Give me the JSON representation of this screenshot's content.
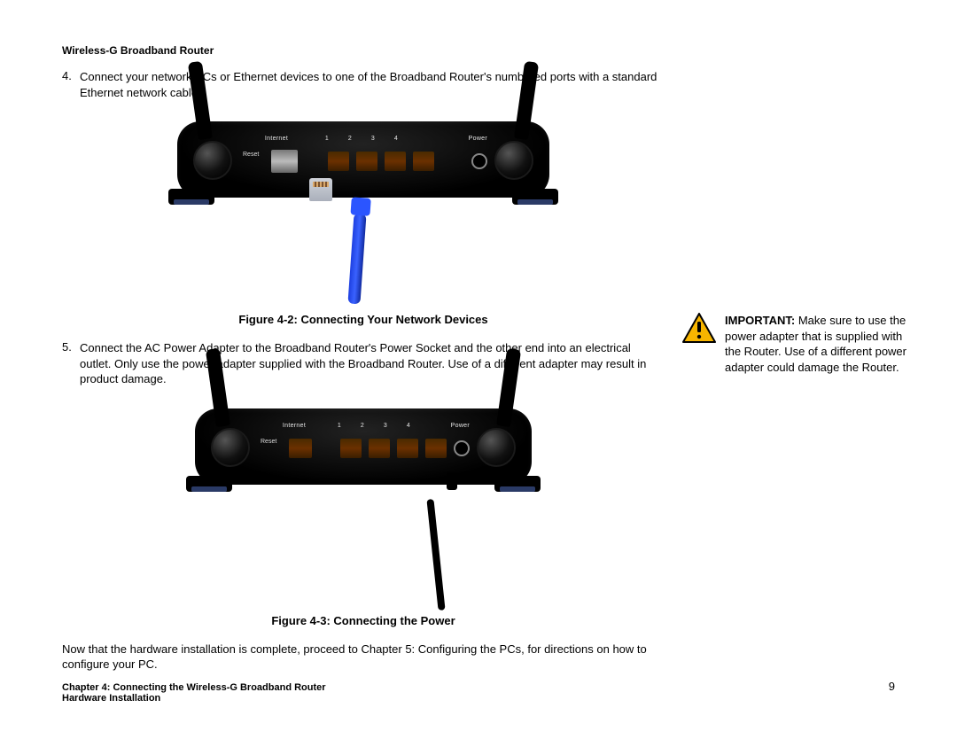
{
  "header": {
    "title": "Wireless-G Broadband Router"
  },
  "step4": {
    "number": "4.",
    "text": "Connect your network PCs or Ethernet devices to one of the Broadband Router's numbered ports with a standard Ethernet network cable."
  },
  "figure42": {
    "caption": "Figure 4-2: Connecting Your Network Devices",
    "labels": {
      "reset": "Reset",
      "internet": "Internet",
      "p1": "1",
      "p2": "2",
      "p3": "3",
      "p4": "4",
      "power": "Power"
    }
  },
  "step5": {
    "number": "5.",
    "text": "Connect the AC Power Adapter to the Broadband Router's Power Socket and the other end into an electrical outlet. Only use the power adapter supplied with the Broadband Router. Use of a different adapter may result in product damage."
  },
  "figure43": {
    "caption": "Figure 4-3: Connecting the Power",
    "labels": {
      "reset": "Reset",
      "internet": "Internet",
      "p1": "1",
      "p2": "2",
      "p3": "3",
      "p4": "4",
      "power": "Power"
    }
  },
  "closing": "Now that the hardware installation is complete, proceed to Chapter 5: Configuring the PCs, for directions on how to configure your PC.",
  "important": {
    "lead": "IMPORTANT:",
    "text": " Make sure to use the power adapter that is supplied with the Router. Use of a different power adapter could damage the Router."
  },
  "footer": {
    "line1": "Chapter 4: Connecting the Wireless-G Broadband Router",
    "line2": "Hardware Installation",
    "page": "9"
  }
}
